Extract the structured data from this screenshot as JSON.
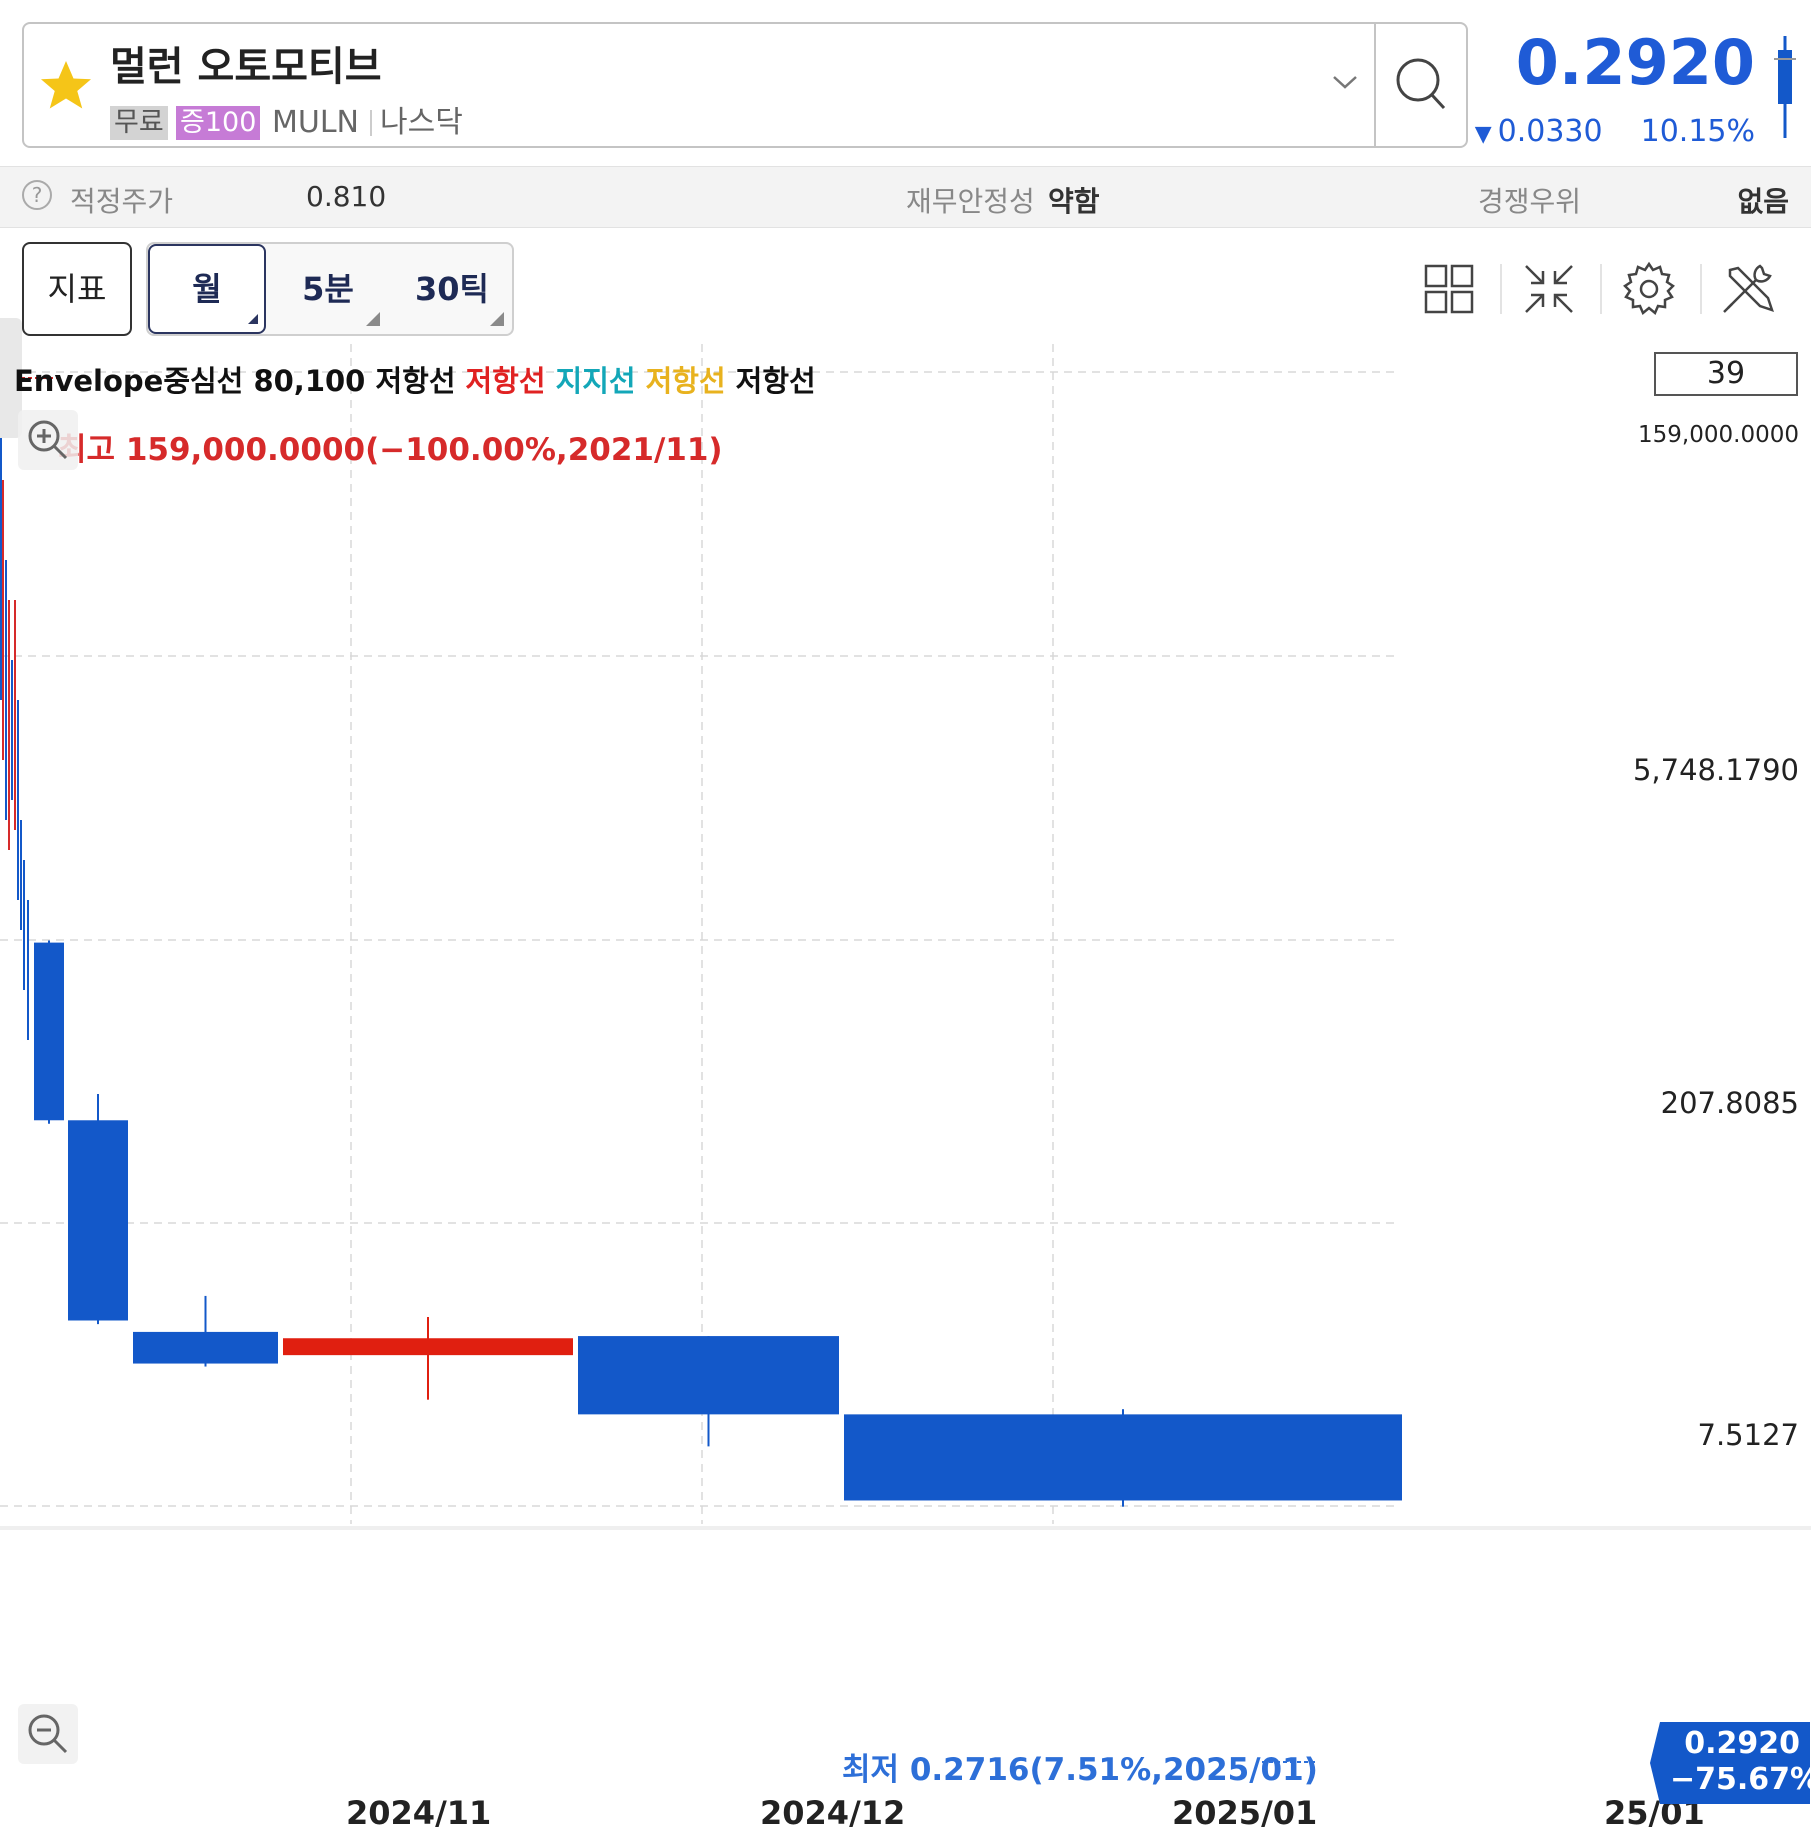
{
  "stock": {
    "name": "멀런 오토모티브",
    "tag_free": "무료",
    "tag_margin": "증100",
    "ticker": "MULN",
    "exchange": "나스닥"
  },
  "price": {
    "current": "0.2920",
    "change": "0.0330",
    "change_pct": "10.15%",
    "direction": "down",
    "color": "#1f5bd6"
  },
  "fundamentals": {
    "fair_price_label": "적정주가",
    "fair_price_value": "0.810",
    "stability_label": "재무안정성",
    "stability_value": "약함",
    "advantage_label": "경쟁우위",
    "advantage_value": "없음"
  },
  "toolbar": {
    "indicator_label": "지표",
    "periods": [
      "월",
      "5분",
      "30틱"
    ],
    "selected_period": "월",
    "icons": [
      "layout-grid-icon",
      "collapse-icon",
      "gear-icon",
      "tools-icon"
    ]
  },
  "legend": {
    "prefix": "Envelope중심선 80,100 저항선",
    "items": [
      {
        "label": "저항선",
        "color": "#e02222"
      },
      {
        "label": "지지선",
        "color": "#13a7b8"
      },
      {
        "label": "저항선",
        "color": "#e8b21e"
      },
      {
        "label": "저항선",
        "color": "#111111"
      }
    ]
  },
  "chart": {
    "visible_count": "39",
    "high_note": "최고 159,000.0000(−100.00%,2021/11)",
    "low_note": "최저 0.2716(7.51%,2025/01)",
    "current_label_price": "0.2920",
    "current_label_pct": "−75.67%"
  },
  "chart_data": {
    "type": "candlestick",
    "scale": "log",
    "y_ticks": [
      "159,000.0000",
      "5,748.1790",
      "207.8085",
      "7.5127"
    ],
    "x_ticks": [
      "2024/11",
      "2024/12",
      "2025/01",
      "25/01"
    ],
    "up_color": "#e01f10",
    "down_color": "#1358c9",
    "candles": [
      {
        "open": 200,
        "high": 205,
        "low": 24,
        "close": 25,
        "dir": "down"
      },
      {
        "open": 25,
        "high": 34,
        "low": 2.3,
        "close": 2.4,
        "dir": "down"
      },
      {
        "open": 2.1,
        "high": 3.2,
        "low": 1.4,
        "close": 1.45,
        "dir": "down"
      },
      {
        "open": 1.6,
        "high": 2.5,
        "low": 0.95,
        "close": 1.95,
        "dir": "up"
      },
      {
        "open": 2.0,
        "high": 2.0,
        "low": 0.55,
        "close": 0.8,
        "dir": "down"
      },
      {
        "open": 0.8,
        "high": 0.85,
        "low": 0.2716,
        "close": 0.292,
        "dir": "down"
      }
    ]
  }
}
